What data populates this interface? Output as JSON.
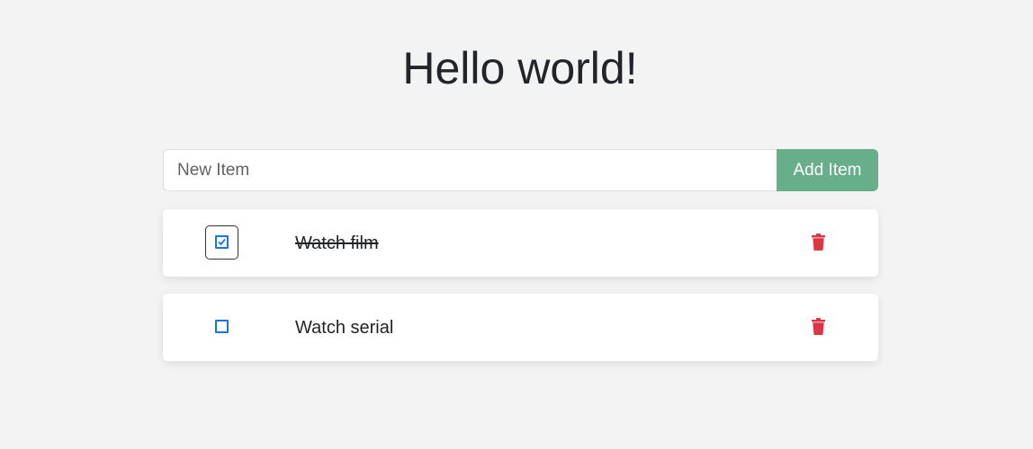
{
  "header": {
    "title": "Hello world!"
  },
  "add_form": {
    "placeholder": "New Item",
    "value": "",
    "button_label": "Add Item"
  },
  "items": [
    {
      "text": "Watch film",
      "completed": true,
      "focused": true
    },
    {
      "text": "Watch serial",
      "completed": false,
      "focused": false
    }
  ],
  "colors": {
    "background": "#f3f3f3",
    "accent_green": "#67ae8b",
    "checkbox_blue": "#1a73e8",
    "delete_red": "#dc3545"
  },
  "icons": {
    "checkbox_checked": "checkbox-checked-icon",
    "checkbox_empty": "checkbox-empty-icon",
    "delete": "trash-icon"
  }
}
